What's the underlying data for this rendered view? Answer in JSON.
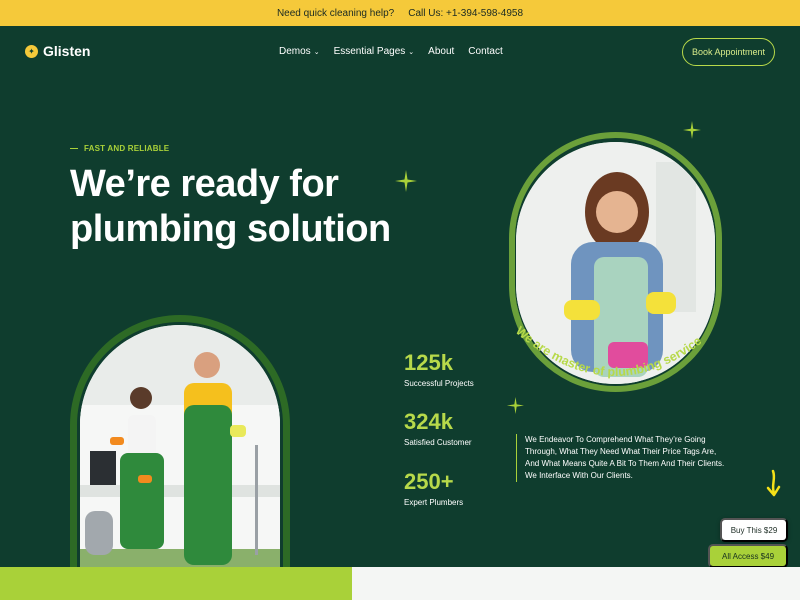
{
  "topbar": {
    "prompt": "Need quick cleaning help?",
    "phone": "Call Us: +1-394-598-4958"
  },
  "nav": {
    "logo": "Glisten",
    "items": [
      {
        "label": "Demos",
        "has_dropdown": true
      },
      {
        "label": "Essential Pages",
        "has_dropdown": true
      },
      {
        "label": "About",
        "has_dropdown": false
      },
      {
        "label": "Contact",
        "has_dropdown": false
      }
    ],
    "cta": "Book Appointment"
  },
  "hero": {
    "kicker": "FAST AND RELIABLE",
    "headline_line1": "We’re ready for",
    "headline_line2": "plumbing solution",
    "curved_text": "We are master of plumbing service",
    "description": "We Endeavor To Comprehend What They’re Going Through, What They Need What Their Price Tags Are, And What Means Quite A Bit To Them And Their Clients. We Interface With Our Clients."
  },
  "stats": [
    {
      "value": "125k",
      "label": "Successful Projects"
    },
    {
      "value": "324k",
      "label": "Satisfied Customer"
    },
    {
      "value": "250+",
      "label": "Expert Plumbers"
    }
  ],
  "floating": {
    "buy": "Buy This $29",
    "access": "All Access $49"
  },
  "colors": {
    "bg": "#0f3d2e",
    "accent": "#a9d139",
    "topbar": "#f5c93a"
  }
}
